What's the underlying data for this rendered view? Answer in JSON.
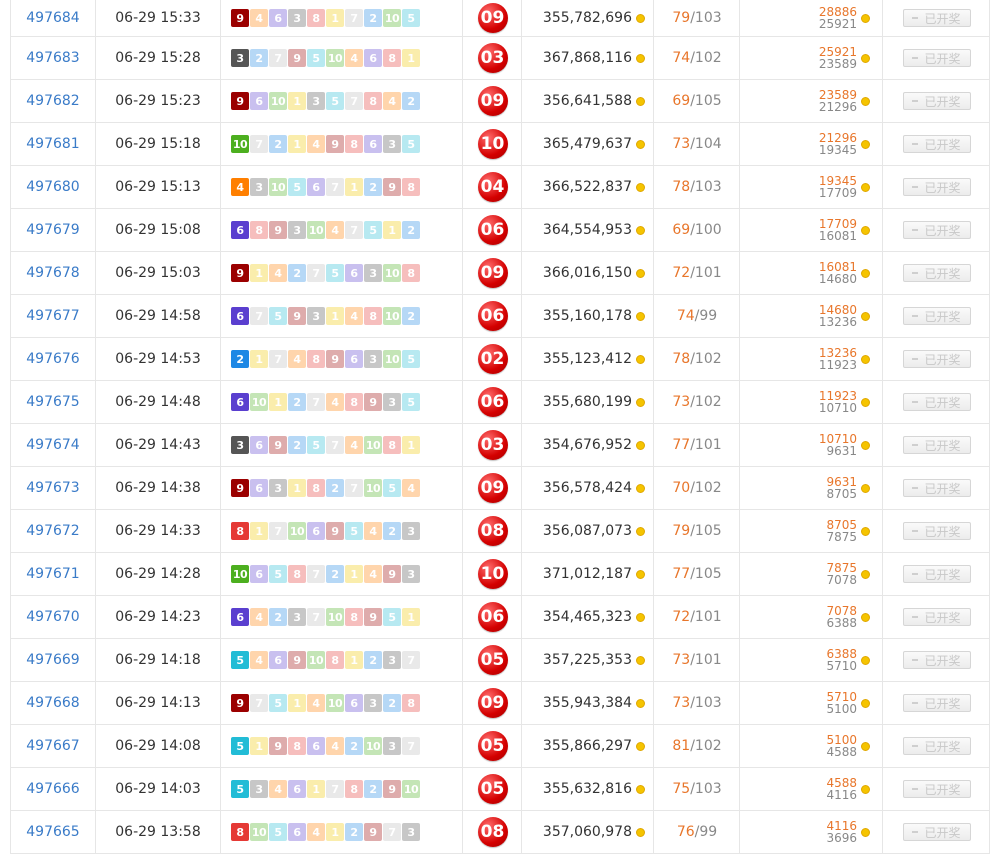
{
  "colors": {
    "1": "#f0c800",
    "2": "#1e88e5",
    "3": "#555555",
    "4": "#ff7f00",
    "5": "#22bcd6",
    "6": "#5a3fcf",
    "7": "#bdbdbd",
    "8": "#e53935",
    "9": "#9b0000",
    "10": "#4caf1f"
  },
  "button_label": "已开奖",
  "rows": [
    {
      "issue": "497684",
      "time": "06-29 15:33",
      "nums": [
        "9",
        "4",
        "6",
        "3",
        "8",
        "1",
        "7",
        "2",
        "10",
        "5"
      ],
      "result": "09",
      "amount": "355,782,696",
      "won": "79",
      "total": "103",
      "pool_top": "28886",
      "pool_bot": "25921"
    },
    {
      "issue": "497683",
      "time": "06-29 15:28",
      "nums": [
        "3",
        "2",
        "7",
        "9",
        "5",
        "10",
        "4",
        "6",
        "8",
        "1"
      ],
      "result": "03",
      "amount": "367,868,116",
      "won": "74",
      "total": "102",
      "pool_top": "25921",
      "pool_bot": "23589"
    },
    {
      "issue": "497682",
      "time": "06-29 15:23",
      "nums": [
        "9",
        "6",
        "10",
        "1",
        "3",
        "5",
        "7",
        "8",
        "4",
        "2"
      ],
      "result": "09",
      "amount": "356,641,588",
      "won": "69",
      "total": "105",
      "pool_top": "23589",
      "pool_bot": "21296"
    },
    {
      "issue": "497681",
      "time": "06-29 15:18",
      "nums": [
        "10",
        "7",
        "2",
        "1",
        "4",
        "9",
        "8",
        "6",
        "3",
        "5"
      ],
      "result": "10",
      "amount": "365,479,637",
      "won": "73",
      "total": "104",
      "pool_top": "21296",
      "pool_bot": "19345"
    },
    {
      "issue": "497680",
      "time": "06-29 15:13",
      "nums": [
        "4",
        "3",
        "10",
        "5",
        "6",
        "7",
        "1",
        "2",
        "9",
        "8"
      ],
      "result": "04",
      "amount": "366,522,837",
      "won": "78",
      "total": "103",
      "pool_top": "19345",
      "pool_bot": "17709"
    },
    {
      "issue": "497679",
      "time": "06-29 15:08",
      "nums": [
        "6",
        "8",
        "9",
        "3",
        "10",
        "4",
        "7",
        "5",
        "1",
        "2"
      ],
      "result": "06",
      "amount": "364,554,953",
      "won": "69",
      "total": "100",
      "pool_top": "17709",
      "pool_bot": "16081"
    },
    {
      "issue": "497678",
      "time": "06-29 15:03",
      "nums": [
        "9",
        "1",
        "4",
        "2",
        "7",
        "5",
        "6",
        "3",
        "10",
        "8"
      ],
      "result": "09",
      "amount": "366,016,150",
      "won": "72",
      "total": "101",
      "pool_top": "16081",
      "pool_bot": "14680"
    },
    {
      "issue": "497677",
      "time": "06-29 14:58",
      "nums": [
        "6",
        "7",
        "5",
        "9",
        "3",
        "1",
        "4",
        "8",
        "10",
        "2"
      ],
      "result": "06",
      "amount": "355,160,178",
      "won": "74",
      "total": "99",
      "pool_top": "14680",
      "pool_bot": "13236"
    },
    {
      "issue": "497676",
      "time": "06-29 14:53",
      "nums": [
        "2",
        "1",
        "7",
        "4",
        "8",
        "9",
        "6",
        "3",
        "10",
        "5"
      ],
      "result": "02",
      "amount": "355,123,412",
      "won": "78",
      "total": "102",
      "pool_top": "13236",
      "pool_bot": "11923"
    },
    {
      "issue": "497675",
      "time": "06-29 14:48",
      "nums": [
        "6",
        "10",
        "1",
        "2",
        "7",
        "4",
        "8",
        "9",
        "3",
        "5"
      ],
      "result": "06",
      "amount": "355,680,199",
      "won": "73",
      "total": "102",
      "pool_top": "11923",
      "pool_bot": "10710"
    },
    {
      "issue": "497674",
      "time": "06-29 14:43",
      "nums": [
        "3",
        "6",
        "9",
        "2",
        "5",
        "7",
        "4",
        "10",
        "8",
        "1"
      ],
      "result": "03",
      "amount": "354,676,952",
      "won": "77",
      "total": "101",
      "pool_top": "10710",
      "pool_bot": "9631"
    },
    {
      "issue": "497673",
      "time": "06-29 14:38",
      "nums": [
        "9",
        "6",
        "3",
        "1",
        "8",
        "2",
        "7",
        "10",
        "5",
        "4"
      ],
      "result": "09",
      "amount": "356,578,424",
      "won": "70",
      "total": "102",
      "pool_top": "9631",
      "pool_bot": "8705"
    },
    {
      "issue": "497672",
      "time": "06-29 14:33",
      "nums": [
        "8",
        "1",
        "7",
        "10",
        "6",
        "9",
        "5",
        "4",
        "2",
        "3"
      ],
      "result": "08",
      "amount": "356,087,073",
      "won": "79",
      "total": "105",
      "pool_top": "8705",
      "pool_bot": "7875"
    },
    {
      "issue": "497671",
      "time": "06-29 14:28",
      "nums": [
        "10",
        "6",
        "5",
        "8",
        "7",
        "2",
        "1",
        "4",
        "9",
        "3"
      ],
      "result": "10",
      "amount": "371,012,187",
      "won": "77",
      "total": "105",
      "pool_top": "7875",
      "pool_bot": "7078"
    },
    {
      "issue": "497670",
      "time": "06-29 14:23",
      "nums": [
        "6",
        "4",
        "2",
        "3",
        "7",
        "10",
        "8",
        "9",
        "5",
        "1"
      ],
      "result": "06",
      "amount": "354,465,323",
      "won": "72",
      "total": "101",
      "pool_top": "7078",
      "pool_bot": "6388"
    },
    {
      "issue": "497669",
      "time": "06-29 14:18",
      "nums": [
        "5",
        "4",
        "6",
        "9",
        "10",
        "8",
        "1",
        "2",
        "3",
        "7"
      ],
      "result": "05",
      "amount": "357,225,353",
      "won": "73",
      "total": "101",
      "pool_top": "6388",
      "pool_bot": "5710"
    },
    {
      "issue": "497668",
      "time": "06-29 14:13",
      "nums": [
        "9",
        "7",
        "5",
        "1",
        "4",
        "10",
        "6",
        "3",
        "2",
        "8"
      ],
      "result": "09",
      "amount": "355,943,384",
      "won": "73",
      "total": "103",
      "pool_top": "5710",
      "pool_bot": "5100"
    },
    {
      "issue": "497667",
      "time": "06-29 14:08",
      "nums": [
        "5",
        "1",
        "9",
        "8",
        "6",
        "4",
        "2",
        "10",
        "3",
        "7"
      ],
      "result": "05",
      "amount": "355,866,297",
      "won": "81",
      "total": "102",
      "pool_top": "5100",
      "pool_bot": "4588"
    },
    {
      "issue": "497666",
      "time": "06-29 14:03",
      "nums": [
        "5",
        "3",
        "4",
        "6",
        "1",
        "7",
        "8",
        "2",
        "9",
        "10"
      ],
      "result": "05",
      "amount": "355,632,816",
      "won": "75",
      "total": "103",
      "pool_top": "4588",
      "pool_bot": "4116"
    },
    {
      "issue": "497665",
      "time": "06-29 13:58",
      "nums": [
        "8",
        "10",
        "5",
        "6",
        "4",
        "1",
        "2",
        "9",
        "7",
        "3"
      ],
      "result": "08",
      "amount": "357,060,978",
      "won": "76",
      "total": "99",
      "pool_top": "4116",
      "pool_bot": "3696"
    }
  ]
}
